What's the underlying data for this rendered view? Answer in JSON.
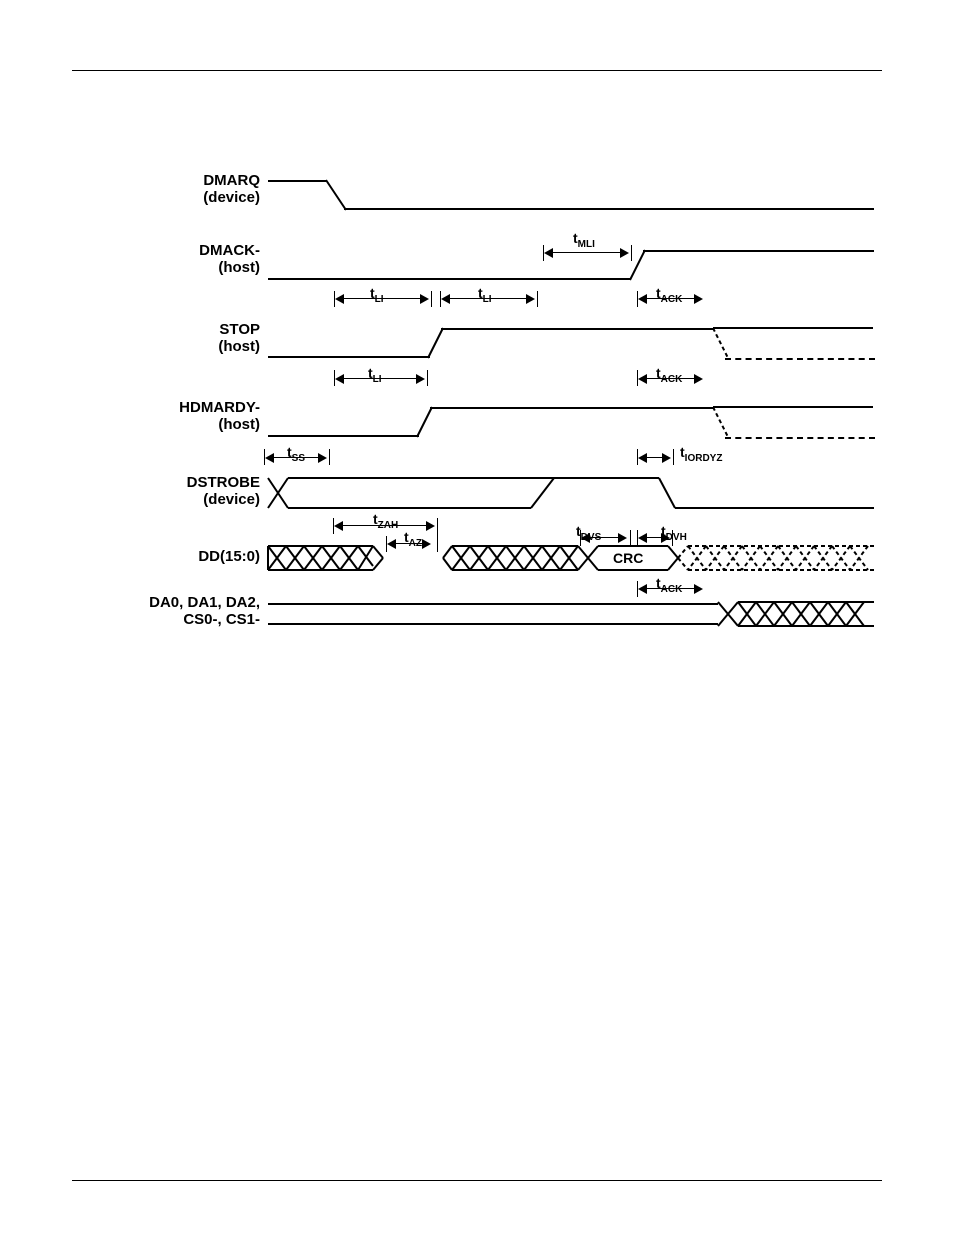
{
  "signals": {
    "dmarq": {
      "name": "DMARQ",
      "source": "(device)"
    },
    "dmack": {
      "name": "DMACK-",
      "source": "(host)"
    },
    "stop": {
      "name": "STOP",
      "source": "(host)"
    },
    "hdmardy": {
      "name": "HDMARDY-",
      "source": "(host)"
    },
    "dstrobe": {
      "name": "DSTROBE",
      "source": "(device)"
    },
    "dd": {
      "name": "DD(15:0)",
      "source": ""
    },
    "addr": {
      "name": "DA0, DA1, DA2,",
      "source": "CS0-, CS1-"
    }
  },
  "timing": {
    "tmli": "MLI",
    "tli1": "LI",
    "tli2": "LI",
    "tack1": "ACK",
    "tli3": "LI",
    "tack2": "ACK",
    "tss": "SS",
    "tiordyz": "IORDYZ",
    "tzah": "ZAH",
    "taz": "AZ",
    "tdvs": "DVS",
    "tdvh": "DVH",
    "tack3": "ACK",
    "crc": "CRC"
  }
}
